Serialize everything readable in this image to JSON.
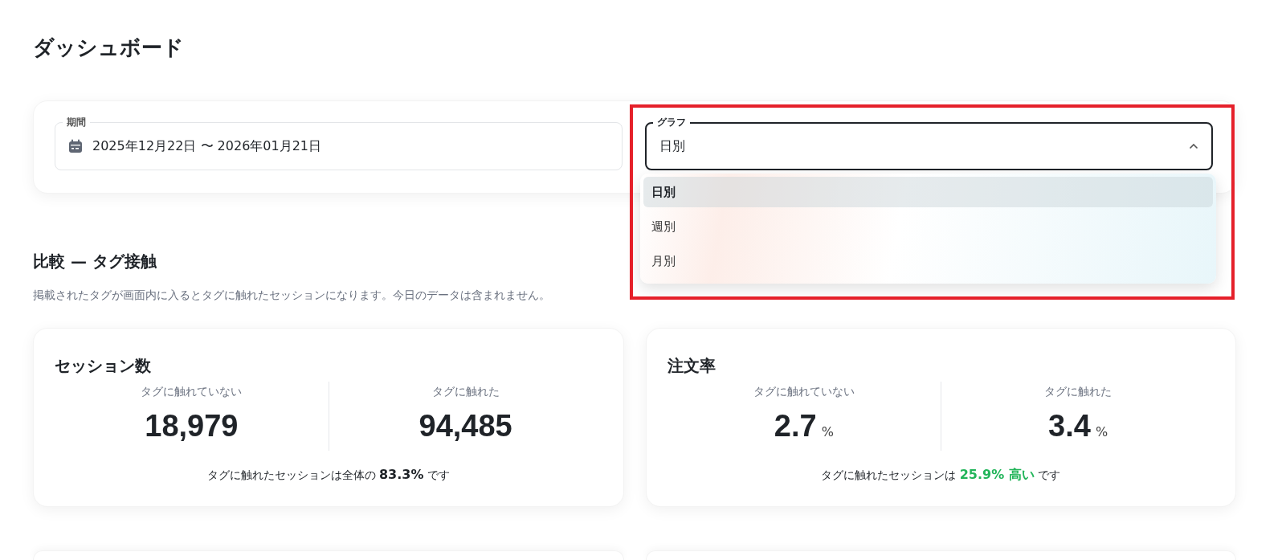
{
  "page_title": "ダッシュボード",
  "filters": {
    "period": {
      "label": "期間",
      "value": "2025年12月22日 〜 2026年01月21日"
    },
    "graph": {
      "label": "グラフ",
      "value": "日別",
      "expanded": true,
      "options": [
        {
          "label": "日別",
          "selected": true
        },
        {
          "label": "週別",
          "selected": false
        },
        {
          "label": "月別",
          "selected": false
        }
      ]
    },
    "highlighted": true
  },
  "section": {
    "title": "比較 — タグ接触",
    "description": "掲載されたタグが画面内に入るとタグに触れたセッションになります。今日のデータは含まれません。"
  },
  "cards": [
    {
      "title": "セッション数",
      "columns": [
        {
          "label": "タグに触れていない",
          "value": "18,979"
        },
        {
          "label": "タグに触れた",
          "value": "94,485"
        }
      ],
      "summary": {
        "prefix": "タグに触れたセッションは全体の",
        "highlight": "83.3%",
        "suffix": "です",
        "color": "#1f2328"
      }
    },
    {
      "title": "注文率",
      "columns": [
        {
          "label": "タグに触れていない",
          "value": "2.7",
          "unit": "%"
        },
        {
          "label": "タグに触れた",
          "value": "3.4",
          "unit": "%"
        }
      ],
      "summary": {
        "prefix": "タグに触れたセッションは",
        "highlight": "25.9% 高い",
        "suffix": "です",
        "color": "#22b55a"
      }
    },
    {
      "kind": "cut-off"
    },
    {
      "kind": "cut-off"
    }
  ]
}
